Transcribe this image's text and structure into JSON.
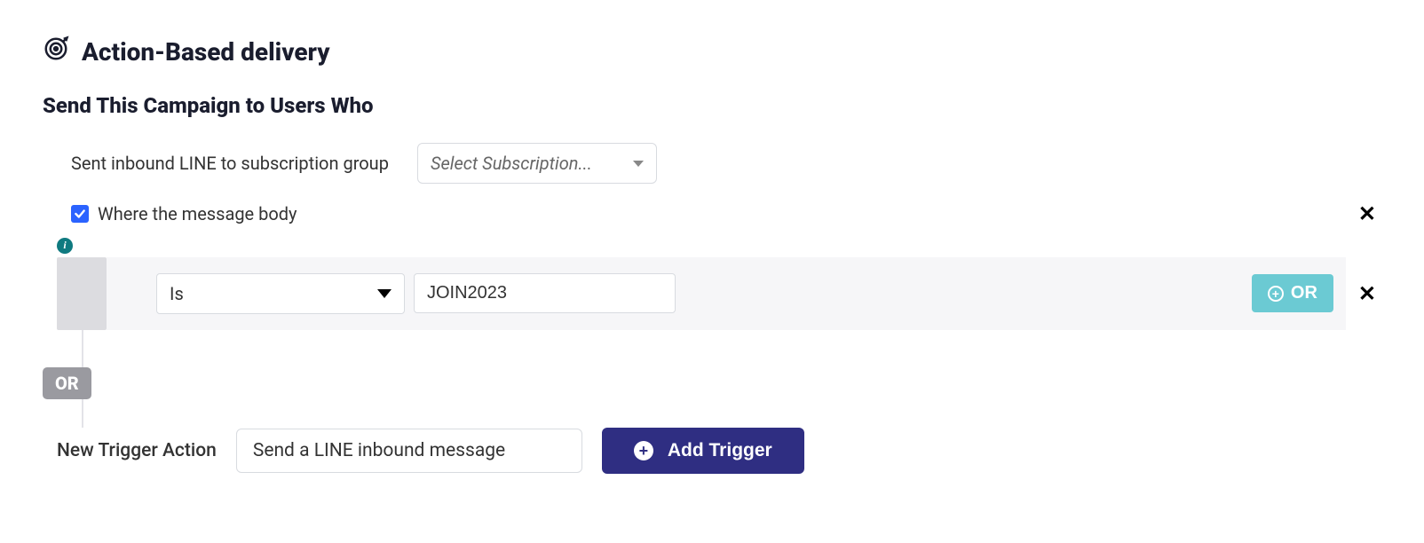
{
  "title": "Action-Based delivery",
  "section_heading": "Send This Campaign to Users Who",
  "trigger": {
    "label": "Sent inbound LINE to subscription group",
    "subscription_select_placeholder": "Select Subscription...",
    "subscription_selected": ""
  },
  "filter": {
    "checkbox_checked": true,
    "checkbox_label": "Where the message body",
    "condition_operator": "Is",
    "condition_value": "JOIN2023",
    "or_button_label": "OR"
  },
  "connector_label": "OR",
  "new_trigger": {
    "label": "New Trigger Action",
    "action_selected": "Send a LINE inbound message",
    "add_button_label": "Add Trigger"
  }
}
